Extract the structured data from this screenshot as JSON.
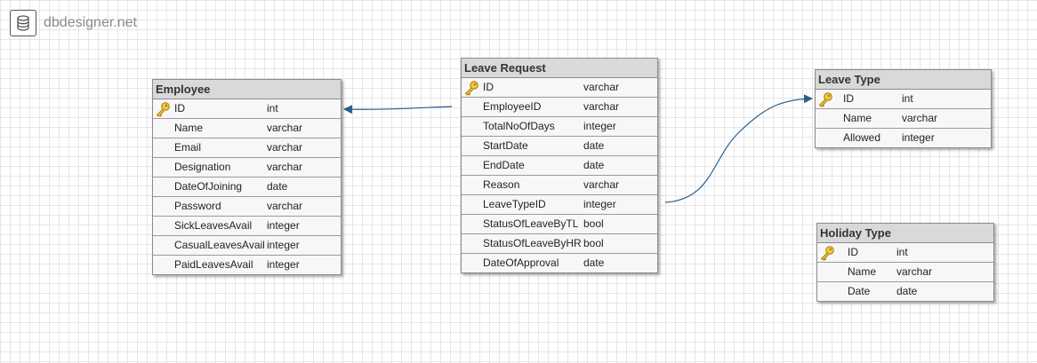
{
  "brand": {
    "name": "dbdesigner.net",
    "icon": "database-icon"
  },
  "colors": {
    "connector": "#2e5d8c",
    "header_bg": "#d9d9d9",
    "key": "#e0b020"
  },
  "tables": {
    "employee": {
      "title": "Employee",
      "rows": [
        {
          "name": "ID",
          "type": "int",
          "pk": true
        },
        {
          "name": "Name",
          "type": "varchar"
        },
        {
          "name": "Email",
          "type": "varchar"
        },
        {
          "name": "Designation",
          "type": "varchar"
        },
        {
          "name": "DateOfJoining",
          "type": "date"
        },
        {
          "name": "Password",
          "type": "varchar"
        },
        {
          "name": "SickLeavesAvail",
          "type": "integer"
        },
        {
          "name": "CasualLeavesAvail",
          "type": "integer"
        },
        {
          "name": "PaidLeavesAvail",
          "type": "integer"
        }
      ]
    },
    "leave_request": {
      "title": "Leave Request",
      "rows": [
        {
          "name": "ID",
          "type": "varchar",
          "pk": true
        },
        {
          "name": "EmployeeID",
          "type": "varchar"
        },
        {
          "name": "TotalNoOfDays",
          "type": "integer"
        },
        {
          "name": "StartDate",
          "type": "date"
        },
        {
          "name": "EndDate",
          "type": "date"
        },
        {
          "name": "Reason",
          "type": "varchar"
        },
        {
          "name": "LeaveTypeID",
          "type": "integer"
        },
        {
          "name": "StatusOfLeaveByTL",
          "type": "bool"
        },
        {
          "name": "StatusOfLeaveByHR",
          "type": "bool"
        },
        {
          "name": "DateOfApproval",
          "type": "date"
        }
      ]
    },
    "leave_type": {
      "title": "Leave Type",
      "rows": [
        {
          "name": "ID",
          "type": "int",
          "pk": true
        },
        {
          "name": "Name",
          "type": "varchar"
        },
        {
          "name": "Allowed",
          "type": "integer"
        }
      ]
    },
    "holiday_type": {
      "title": "Holiday Type",
      "rows": [
        {
          "name": "ID",
          "type": "int",
          "pk": true
        },
        {
          "name": "Name",
          "type": "varchar"
        },
        {
          "name": "Date",
          "type": "date"
        }
      ]
    }
  }
}
